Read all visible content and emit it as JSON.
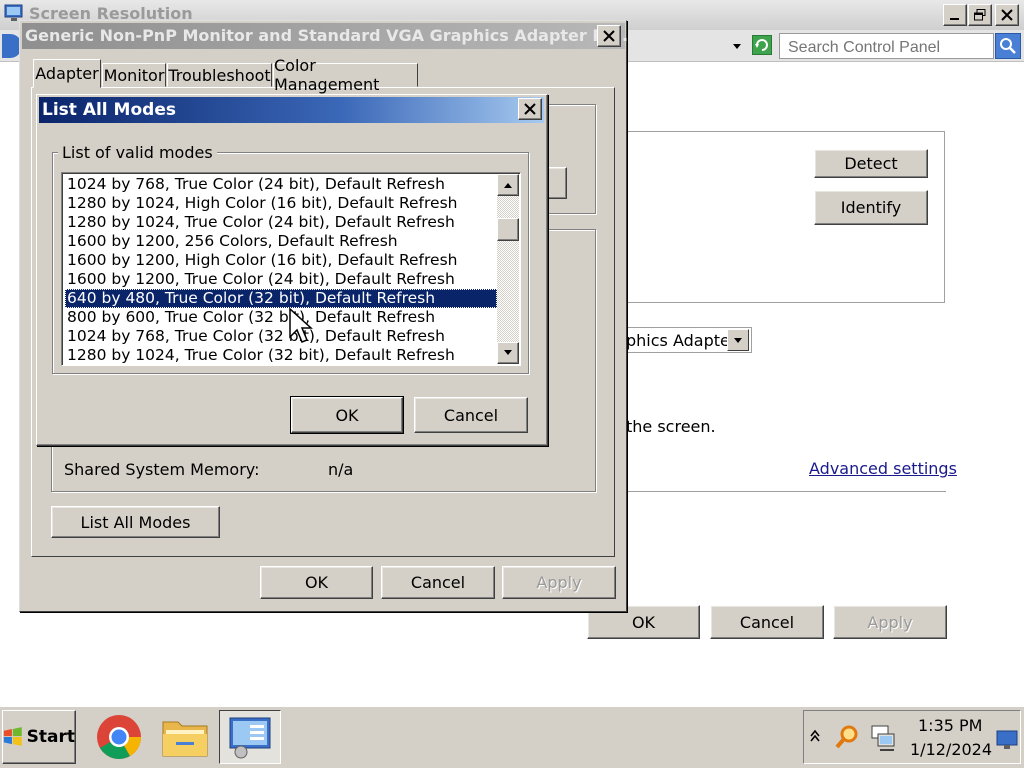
{
  "background_window": {
    "title": "Screen Resolution",
    "search_placeholder": "Search Control Panel",
    "detect_label": "Detect",
    "identify_label": "Identify",
    "display_combo_value": "phics Adapter",
    "screen_text": "the screen.",
    "advanced_link": "Advanced settings",
    "ok_label": "OK",
    "cancel_label": "Cancel",
    "apply_label": "Apply"
  },
  "properties_dialog": {
    "title": "Generic Non-PnP Monitor and Standard VGA Graphics Adapter Pr...",
    "tabs": [
      {
        "label": "Adapter",
        "active": true
      },
      {
        "label": "Monitor",
        "active": false
      },
      {
        "label": "Troubleshoot",
        "active": false
      },
      {
        "label": "Color Management",
        "active": false
      }
    ],
    "shared_memory_label": "Shared System Memory:",
    "shared_memory_value": "n/a",
    "list_all_modes_label": "List All Modes",
    "ok_label": "OK",
    "cancel_label": "Cancel",
    "apply_label": "Apply"
  },
  "modes_dialog": {
    "title": "List All Modes",
    "group_label": "List of valid modes",
    "modes": [
      "1024 by 768, True Color (24 bit), Default Refresh",
      "1280 by 1024, High Color (16 bit), Default Refresh",
      "1280 by 1024, True Color (24 bit), Default Refresh",
      "1600 by 1200, 256 Colors, Default Refresh",
      "1600 by 1200, High Color (16 bit), Default Refresh",
      "1600 by 1200, True Color (24 bit), Default Refresh",
      "640 by 480, True Color (32 bit), Default Refresh",
      "800 by 600, True Color (32 bit), Default Refresh",
      "1024 by 768, True Color (32 bit), Default Refresh",
      "1280 by 1024, True Color (32 bit), Default Refresh"
    ],
    "selected_index": 6,
    "ok_label": "OK",
    "cancel_label": "Cancel"
  },
  "taskbar": {
    "start_label": "Start",
    "apps": [
      {
        "name": "chrome-icon"
      },
      {
        "name": "folder-icon"
      },
      {
        "name": "display-settings-icon"
      }
    ],
    "time": "1:35 PM",
    "date": "1/12/2024"
  },
  "colors": {
    "selection": "#0a246a",
    "face": "#d4d0c8",
    "active_title_start": "#0a246a",
    "active_title_end": "#a6caf0"
  }
}
